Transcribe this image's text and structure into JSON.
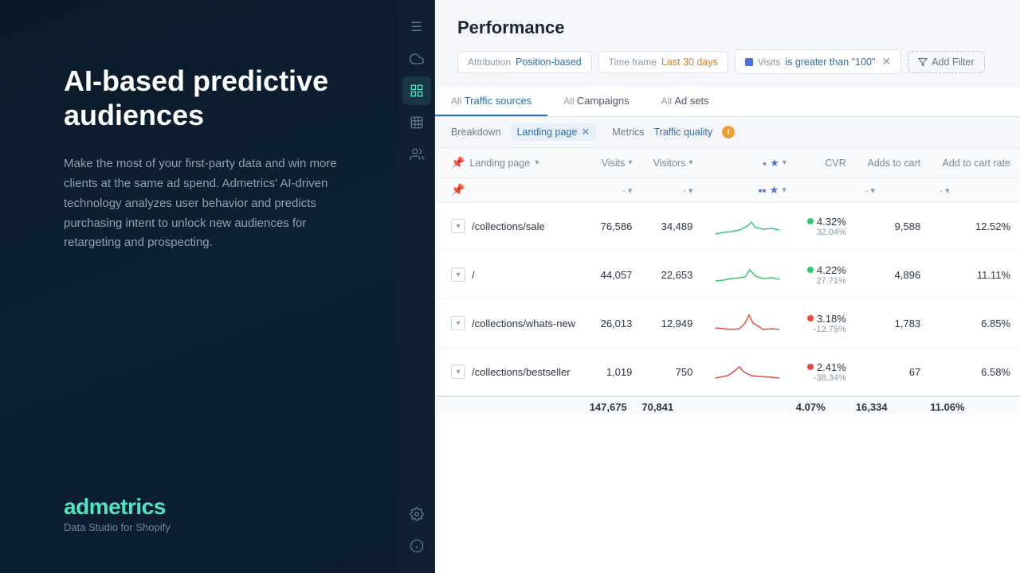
{
  "leftPanel": {
    "title": "AI-based predictive audiences",
    "description": "Make the most of your first-party data and win more clients at the same ad spend. Admetrics' AI-driven technology analyzes user behavior and predicts purchasing intent to unlock new audiences for retargeting and prospecting.",
    "brandName": "admetrics",
    "brandTagline": "Data Studio for Shopify"
  },
  "header": {
    "title": "Performance",
    "filters": {
      "attribution": {
        "label": "Attribution",
        "value": "Position-based"
      },
      "timeframe": {
        "label": "Time frame",
        "value": "Last 30 days"
      },
      "visits": {
        "label": "Visits",
        "value": "is greater than \"100\"",
        "hasClose": true
      },
      "addFilter": "Add Filter"
    }
  },
  "tabs": {
    "trafficSources": {
      "prefix": "All",
      "label": "Traffic sources",
      "active": true
    },
    "campaigns": {
      "prefix": "All",
      "label": "Campaigns"
    },
    "adSets": {
      "prefix": "All",
      "label": "Ad sets"
    }
  },
  "breakdown": {
    "label": "Breakdown",
    "tag": "Landing page",
    "metricsLabel": "Metrics",
    "metricsValue": "Traffic quality",
    "infoTooltip": "!"
  },
  "table": {
    "headers": {
      "landingPage": "Landing page",
      "visits": "Visits",
      "visitors": "Visitors",
      "cvr": "CVR",
      "addsToCart": "Adds to cart",
      "addToCartRate": "Add to cart rate"
    },
    "rows": [
      {
        "landingPage": "/collections/sale",
        "visits": "76,586",
        "visitors": "34,489",
        "cvr": "4.32%",
        "cvrSub": "32.04%",
        "cvrUp": true,
        "addsToCart": "9,588",
        "addToCartRate": "12.52%",
        "sparklineColor": "green"
      },
      {
        "landingPage": "/",
        "visits": "44,057",
        "visitors": "22,653",
        "cvr": "4.22%",
        "cvrSub": "27.71%",
        "cvrUp": true,
        "addsToCart": "4,896",
        "addToCartRate": "11.11%",
        "sparklineColor": "green"
      },
      {
        "landingPage": "/collections/whats-new",
        "visits": "26,013",
        "visitors": "12,949",
        "cvr": "3.18%",
        "cvrSub": "-12.75%",
        "cvrUp": false,
        "addsToCart": "1,783",
        "addToCartRate": "6.85%",
        "sparklineColor": "red"
      },
      {
        "landingPage": "/collections/bestseller",
        "visits": "1,019",
        "visitors": "750",
        "cvr": "2.41%",
        "cvrSub": "-38.34%",
        "cvrUp": false,
        "addsToCart": "67",
        "addToCartRate": "6.58%",
        "sparklineColor": "red"
      }
    ],
    "footer": {
      "visits": "147,675",
      "visitors": "70,841",
      "cvr": "4.07%",
      "addsToCart": "16,334",
      "addToCartRate": "11.06%"
    }
  },
  "sidebar": {
    "icons": [
      {
        "name": "menu-icon",
        "symbol": "☰",
        "active": false
      },
      {
        "name": "cloud-icon",
        "symbol": "⛅",
        "active": false
      },
      {
        "name": "grid-alt-icon",
        "symbol": "▦",
        "active": true
      },
      {
        "name": "grid-icon",
        "symbol": "⊞",
        "active": false
      },
      {
        "name": "user-icon",
        "symbol": "👤",
        "active": false
      },
      {
        "name": "settings-icon",
        "symbol": "⚙",
        "active": false
      },
      {
        "name": "help-icon",
        "symbol": "💡",
        "active": false
      }
    ]
  }
}
